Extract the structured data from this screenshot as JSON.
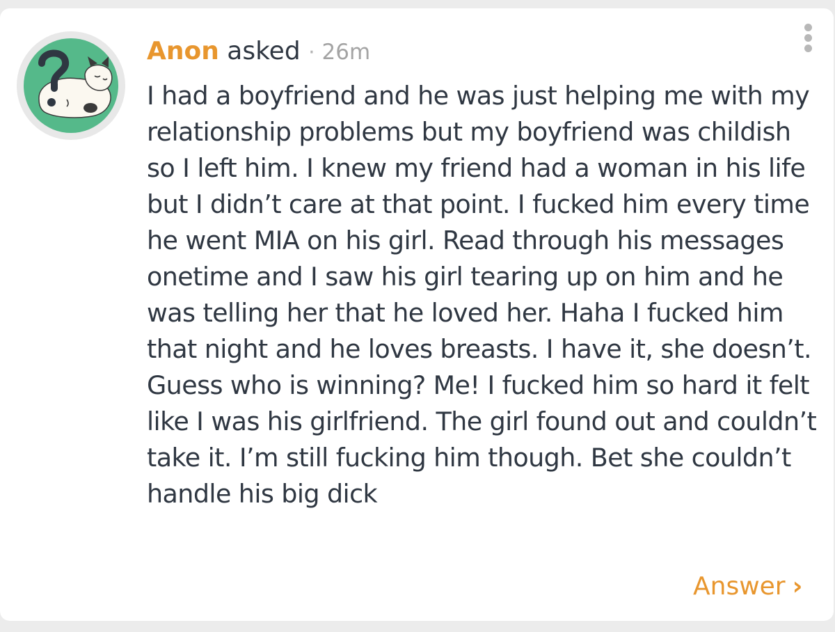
{
  "question_card": {
    "author": "Anon",
    "action": " asked ",
    "separator": "·",
    "time": " 26m",
    "avatar_icon": "cat-question-mark-icon",
    "menu_icon": "vertical-dots-icon",
    "question_text": "I had a boyfriend and he was just helping me with my relationship problems but my boyfriend was childish so I left him. I knew my friend had a woman in his life but I didn’t care at that point. I fucked him every time he went MIA on his girl. Read through his messages onetime and I saw his girl tearing up on him and he was telling her that he loved her. Haha I fucked him that night and he loves breasts. I have it, she doesn’t. Guess who is winning? Me! I fucked him so hard it felt like I was his girlfriend. The girl found out and couldn’t take it. I’m still fucking him though. Bet she couldn’t handle his big dick",
    "answer_label": "Answer",
    "answer_chevron": "›",
    "colors": {
      "accent": "#e8962e",
      "text": "#2f3742",
      "muted": "#a4a4a4",
      "avatar_bg": "#55b98a"
    }
  }
}
